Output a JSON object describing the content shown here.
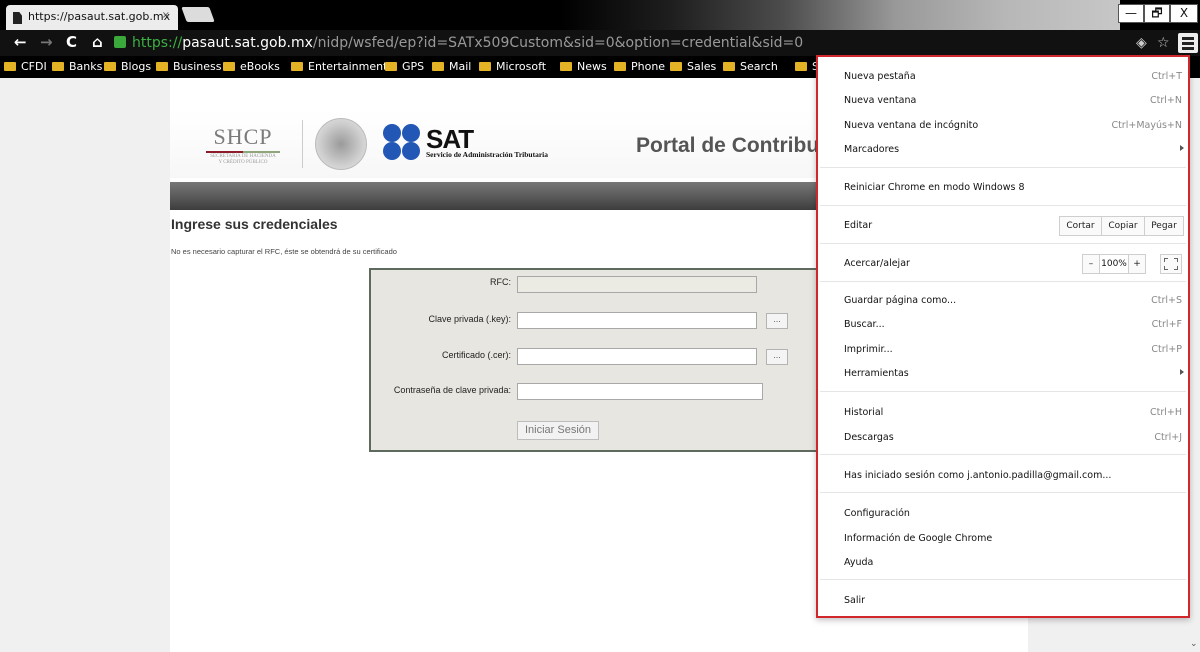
{
  "browser": {
    "tab_title": "https://pasaut.sat.gob.mx",
    "tab_close": "×",
    "window_min": "—",
    "window_max": "🗗",
    "window_close": "X",
    "url": {
      "scheme": "https://",
      "host": "pasaut.sat.gob.mx",
      "path": "/nidp/wsfed/ep?id=SATx509Custom&sid=0&option=credential&sid=0"
    },
    "star": "☆",
    "bookmarks": [
      "CFDI",
      "Banks",
      "Blogs",
      "Business",
      "eBooks",
      "Entertainment",
      "GPS",
      "Mail",
      "Microsoft",
      "News",
      "Phone",
      "Sales",
      "Search",
      "S"
    ]
  },
  "page": {
    "shcp": {
      "title": "SHCP",
      "line1": "SECRETARÍA DE HACIENDA",
      "line2": "Y CRÉDITO PÚBLICO"
    },
    "sat": {
      "word": "SAT",
      "subtitle": "Servicio de Administración Tributaria"
    },
    "portal_title": "Portal de Contribu",
    "heading": "Ingrese sus credenciales",
    "note": "No es necesario capturar el RFC, éste se obtendrá de su certificado",
    "form": {
      "rfc_label": "RFC:",
      "rfc_value": "",
      "key_label": "Clave privada (.key):",
      "cer_label": "Certificado (.cer):",
      "password_label": "Contraseña de clave privada:",
      "browse_label": "...",
      "submit_label": "Iniciar Sesión"
    }
  },
  "menu": {
    "new_tab": {
      "label": "Nueva pestaña",
      "shortcut": "Ctrl+T"
    },
    "new_window": {
      "label": "Nueva ventana",
      "shortcut": "Ctrl+N"
    },
    "incognito": {
      "label": "Nueva ventana de incógnito",
      "shortcut": "Ctrl+Mayús+N"
    },
    "bookmarks": {
      "label": "Marcadores"
    },
    "relaunch": {
      "label": "Reiniciar Chrome en modo Windows 8"
    },
    "edit": {
      "label": "Editar",
      "cut": "Cortar",
      "copy": "Copiar",
      "paste": "Pegar"
    },
    "zoom": {
      "label": "Acercar/alejar",
      "minus": "–",
      "value": "100%",
      "plus": "+"
    },
    "save_page": {
      "label": "Guardar página como...",
      "shortcut": "Ctrl+S"
    },
    "find": {
      "label": "Buscar...",
      "shortcut": "Ctrl+F"
    },
    "print": {
      "label": "Imprimir...",
      "shortcut": "Ctrl+P"
    },
    "tools": {
      "label": "Herramientas"
    },
    "history": {
      "label": "Historial",
      "shortcut": "Ctrl+H"
    },
    "downloads": {
      "label": "Descargas",
      "shortcut": "Ctrl+J"
    },
    "signed_in": {
      "label": "Has iniciado sesión como j.antonio.padilla@gmail.com..."
    },
    "settings": {
      "label": "Configuración"
    },
    "about": {
      "label": "Información de Google Chrome"
    },
    "help": {
      "label": "Ayuda"
    },
    "exit": {
      "label": "Salir"
    }
  },
  "colors": {
    "menu_border": "#d0262c",
    "sat_blue": "#2257b5",
    "secure_green": "#3cb043",
    "folder": "#e4b325"
  }
}
